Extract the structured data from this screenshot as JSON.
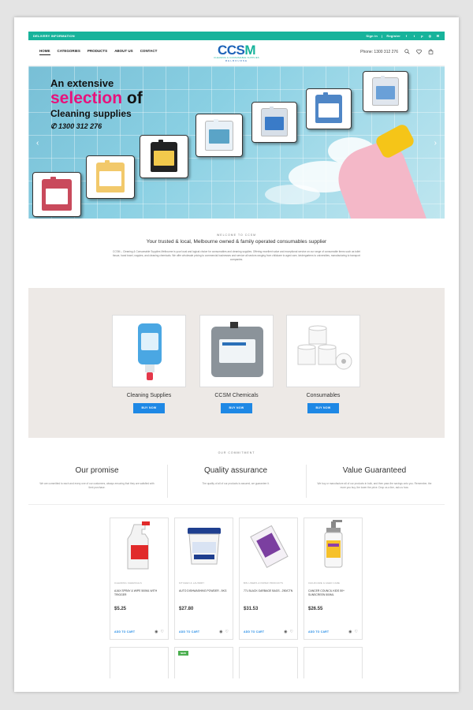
{
  "topbar": {
    "left": "DELIVERY INFORMATION",
    "signin": "Sign in",
    "sep": "|",
    "register": "Register",
    "social": [
      "f",
      "t",
      "p",
      "◎",
      "✉"
    ]
  },
  "nav": [
    "HOME",
    "CATEGORIES",
    "PRODUCTS",
    "ABOUT US",
    "CONTACT"
  ],
  "logo": {
    "mark_a": "CCS",
    "mark_b": "M",
    "sub": "CLEANING & CONSUMABLE SUPPLIES",
    "city": "MELBOURNE"
  },
  "header": {
    "phone": "Phone: 1300 312 276"
  },
  "hero": {
    "line1": "An extensive",
    "line2a": "selection",
    "line2b": "of",
    "line3": "Cleaning supplies",
    "phone": "1300 312 276",
    "prev": "‹",
    "next": "›"
  },
  "welcome": {
    "kicker": "WELCOME TO CCSM",
    "title": "Your trusted & local, Melbourne owned & family operated consumables supplier",
    "body": "CCSM – Cleaning & Consumable Supplies Melbourne is your local and logical choice for consumables and cleaning supplies. Offering excellent value and exceptional service on our range of consumable items such as toilet tissue, hand towel, nappies, and cleaning chemicals. We offer wholesale pricing to commercial businesses and service all sectors ranging from childcare to aged care, kindergartens to universities, manufacturing to transport companies."
  },
  "categories": [
    {
      "name": "Cleaning Supplies",
      "button": "BUY NOW"
    },
    {
      "name": "CCSM Chemicals",
      "button": "BUY NOW"
    },
    {
      "name": "Consumables",
      "button": "BUY NOW"
    }
  ],
  "commitment": {
    "kicker": "OUR COMMITMENT",
    "items": [
      {
        "title": "Our promise",
        "text": "We are committed to each and every one of our customers, always ensuring that they are satisfied with their purchase."
      },
      {
        "title": "Quality assurance",
        "text": "The quality of all of our products is assured, we guarantee it."
      },
      {
        "title": "Value Guaranteed",
        "text": "We buy or manufacture all of our products in bulk, and then pass the savings onto you. Remember, the more you buy, the lower the price. Drop us a line, ask us how."
      }
    ]
  },
  "products": [
    {
      "category": "CLEANING CHEMICALS",
      "name": "AJAX SPRAY & WIPE 500ML WITH TRIGGER",
      "price": "$5.25",
      "cart": "ADD TO CART"
    },
    {
      "category": "KITCHEN & LAUNDRY",
      "name": "AUTO DISHWASHING POWDER - 5KG",
      "price": "$27.80",
      "cart": "ADD TO CART"
    },
    {
      "category": "BIN LINERS & PAPER PRODUCTS",
      "name": "77L BLACK GARBAGE BAGS - 250/CTN",
      "price": "$31.53",
      "cart": "ADD TO CART"
    },
    {
      "category": "CHILDCARE & AGED CARE",
      "name": "CANCER COUNCIL KIDS 50+ SUNSCREEN 500ML",
      "price": "$26.55",
      "cart": "ADD TO CART"
    }
  ],
  "badge_new": "NEW",
  "colors": {
    "teal": "#17b39b",
    "blue": "#1e88e5",
    "pink": "#e7127b",
    "beige": "#ede9e6"
  }
}
